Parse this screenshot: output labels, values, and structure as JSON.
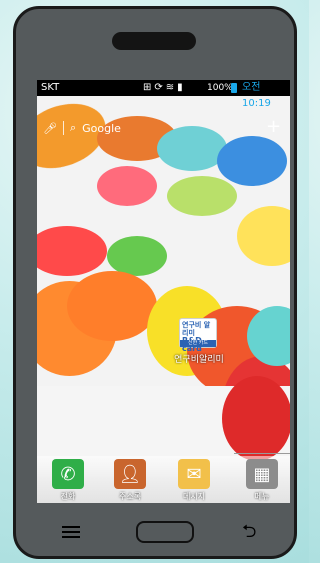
{
  "status_bar": {
    "carrier": "SKT",
    "battery_percent": "100%",
    "time": "오전 10:19"
  },
  "search": {
    "brand": "Google"
  },
  "home_app": {
    "icon_line1": "연구비 알리미",
    "icon_line2": "R&D card",
    "icon_footer": "신한 카드",
    "label": "연구비알리미"
  },
  "dock": [
    {
      "label": "전화",
      "icon": "phone-icon",
      "color": "#2fae48"
    },
    {
      "label": "주소록",
      "icon": "contacts-icon",
      "color": "#c9652d"
    },
    {
      "label": "메시지",
      "icon": "message-icon",
      "color": "#f2c04a"
    },
    {
      "label": "메뉴",
      "icon": "apps-grid-icon",
      "color": "#8c8c8c"
    }
  ],
  "colors": {
    "status_time": "#1aa7e8",
    "phone_body": "#555a5c"
  }
}
